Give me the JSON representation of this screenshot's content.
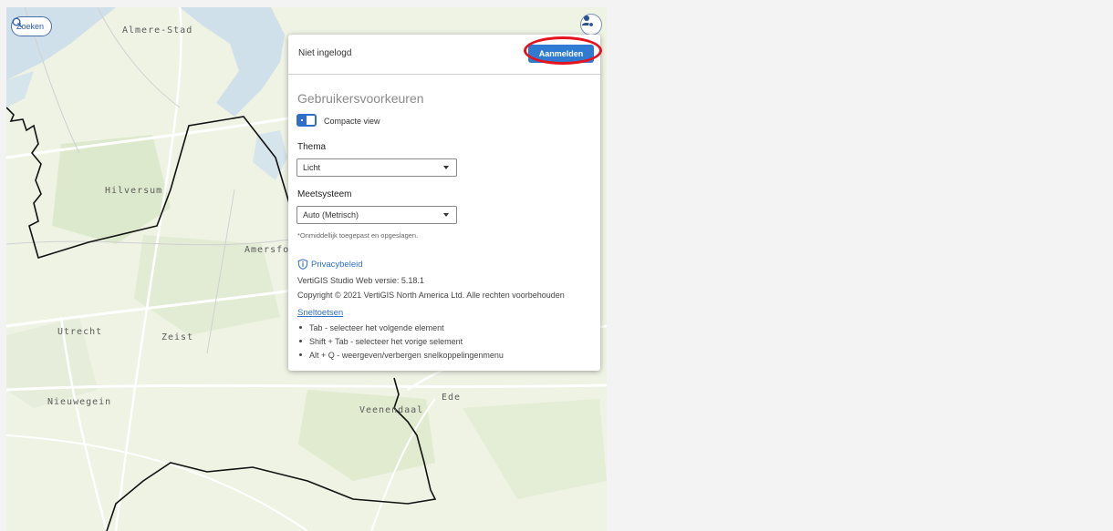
{
  "map": {
    "labels": {
      "almere": "Almere-Stad",
      "hilversum": "Hilversum",
      "amersfoort": "Amersfo",
      "utrecht": "Utrecht",
      "zeist": "Zeist",
      "nieuwegein": "Nieuwegein",
      "ede": "Ede",
      "veenendaal": "Veenendaal"
    }
  },
  "search": {
    "label": "Zoeken"
  },
  "panel": {
    "status": "Niet ingelogd",
    "signin_label": "Aanmelden",
    "section_title": "Gebruikersvoorkeuren",
    "compact_view_label": "Compacte view",
    "theme": {
      "label": "Thema",
      "value": "Licht"
    },
    "measure": {
      "label": "Meetsysteem",
      "value": "Auto (Metrisch)"
    },
    "note": "*Onmiddellijk toegepast en opgeslagen.",
    "privacy_label": "Privacybeleid",
    "version": "VertiGIS Studio Web versie: 5.18.1",
    "copyright": "Copyright © 2021 VertiGIS North America Ltd. Alle rechten voorbehouden",
    "shortcuts_title": "Sneltoetsen",
    "shortcuts": [
      "Tab - selecteer het volgende element",
      "Shift + Tab - selecteer het vorige selement",
      "Alt + Q - weergeven/verbergen snelkoppelingenmenu"
    ]
  },
  "colors": {
    "accent": "#2f7bd2",
    "highlight": "#e4131d"
  }
}
